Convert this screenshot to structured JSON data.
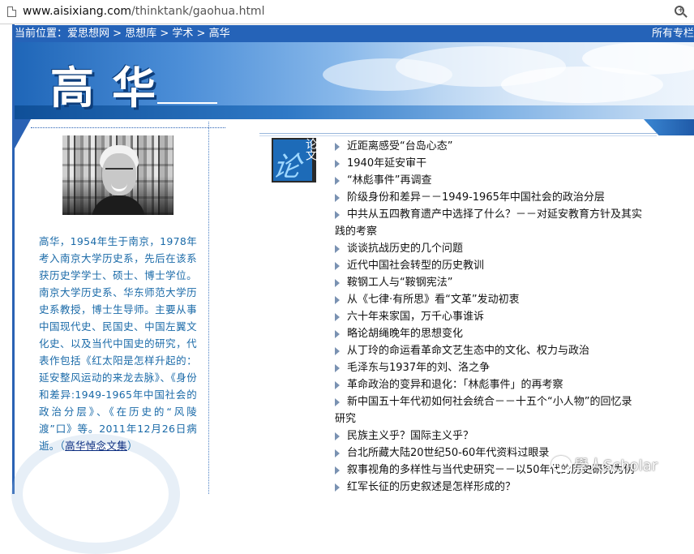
{
  "browser": {
    "url_host": "www.aisixiang.com",
    "url_path": "/thinktank/gaohua.html",
    "icons": {
      "page": "page-icon",
      "zoom": "zoom-icon"
    }
  },
  "breadcrumb": {
    "prefix": "当前位置：",
    "items": [
      "爱思想网",
      "思想库",
      "学术",
      "高华"
    ],
    "separator": " > ",
    "right_link": "所有专栏"
  },
  "banner": {
    "title": "高华"
  },
  "profile": {
    "bio": "高华，1954年生于南京，1978年考入南京大学历史系，先后在该系获历史学学士、硕士、博士学位。南京大学历史系、华东师范大学历史系教授，博士生导师。主要从事中国现代史、民国史、中国左翼文化史、以及当代中国史的研究，代表作包括《红太阳是怎样升起的：延安整风运动的来龙去脉》、《身份和差异:1949-1965年中国社会的政治分层》、《在历史的“风陵渡”口》等。2011年12月26日病逝。（",
    "memorial_link": "高华悼念文集",
    "bio_end": "）"
  },
  "section_logo": {
    "char1": "论",
    "char2": "论文"
  },
  "articles": [
    "近距离感受“台岛心态”",
    "1940年延安审干",
    "“林彪事件”再调查",
    "阶级身份和差异－－1949-1965年中国社会的政治分层",
    "中共从五四教育遗产中选择了什么？－－对延安教育方针及其实",
    "践的考察",
    "谈谈抗战历史的几个问题",
    "近代中国社会转型的历史教训",
    "鞍钢工人与“鞍钢宪法”",
    "从《七律·有所思》看“文革”发动初衷",
    "六十年来家国，万千心事谁诉",
    "略论胡绳晚年的思想变化",
    "从丁玲的命运看革命文艺生态中的文化、权力与政治",
    "毛泽东与1937年的刘、洛之争",
    "革命政治的变异和退化：「林彪事件」的再考察",
    "新中国五十年代初如何社会统合－－十五个“小人物”的回忆录",
    "研究",
    "民族主义乎？国际主义乎？",
    "台北所藏大陆20世纪50-60年代资料过眼录",
    "叙事视角的多样性与当代史研究－－以50年代的历史研究为例",
    "红军长征的历史叙述是怎样形成的？"
  ],
  "continuation_rows": [
    5,
    16
  ],
  "watermark": {
    "text": "學人Scholar",
    "icon": "wechat-icon"
  },
  "colors": {
    "brand_blue": "#2563b8",
    "bio_text": "#1a6aa8",
    "bullet": "#7a92b2"
  }
}
